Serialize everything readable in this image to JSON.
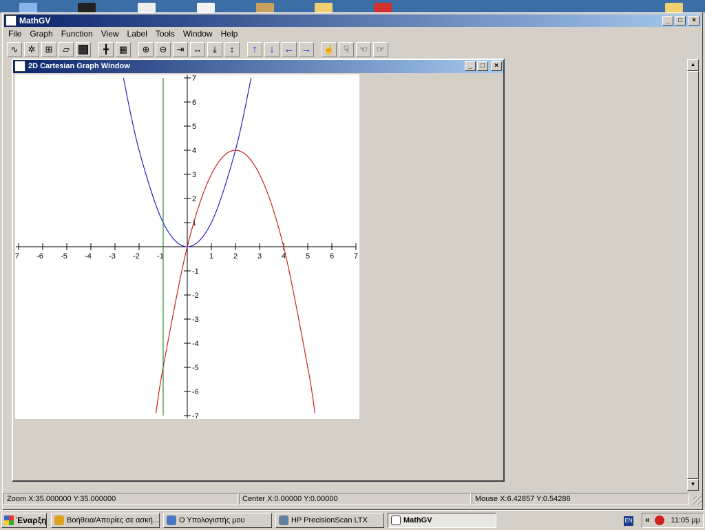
{
  "app": {
    "title": "MathGV",
    "window_buttons": [
      "_",
      "□",
      "×"
    ]
  },
  "menu": [
    "File",
    "Graph",
    "Function",
    "View",
    "Label",
    "Tools",
    "Window",
    "Help"
  ],
  "toolbar": [
    {
      "name": "graph-function-icon"
    },
    {
      "name": "polar-graph-icon"
    },
    {
      "name": "grid-graph-icon"
    },
    {
      "name": "open-folder-icon"
    },
    {
      "name": "save-disk-icon"
    },
    {
      "name": "axes-icon"
    },
    {
      "name": "grid-icon"
    },
    {
      "name": "zoom-in-icon"
    },
    {
      "name": "zoom-out-icon"
    },
    {
      "name": "shrink-horizontal-icon"
    },
    {
      "name": "expand-horizontal-icon"
    },
    {
      "name": "shrink-vertical-icon"
    },
    {
      "name": "expand-vertical-icon"
    },
    {
      "name": "arrow-up-icon"
    },
    {
      "name": "arrow-down-icon"
    },
    {
      "name": "arrow-left-icon"
    },
    {
      "name": "arrow-right-icon"
    },
    {
      "name": "hand-up-icon"
    },
    {
      "name": "hand-down-icon"
    },
    {
      "name": "hand-left-icon"
    },
    {
      "name": "hand-right-icon"
    }
  ],
  "child_window": {
    "title": "2D Cartesian Graph Window"
  },
  "chart_data": {
    "type": "line",
    "xlim": [
      -7,
      7
    ],
    "ylim": [
      -7,
      7
    ],
    "grid": false,
    "x_ticks": [
      -7,
      -6,
      -5,
      -4,
      -3,
      -2,
      -1,
      1,
      2,
      3,
      4,
      5,
      6,
      7
    ],
    "y_ticks": [
      7,
      6,
      5,
      4,
      3,
      2,
      1,
      -1,
      -2,
      -3,
      -4,
      -5,
      -6,
      -7
    ],
    "series": [
      {
        "color": "#1f1fc8",
        "x": [
          -2.65,
          -2,
          -1,
          0,
          1,
          2,
          2.65
        ],
        "y": [
          7,
          4,
          1,
          0,
          1,
          4,
          7
        ]
      },
      {
        "color": "#cc1f1f",
        "x": [
          -1.3,
          -1,
          0,
          1,
          2,
          3,
          4,
          5,
          5.3
        ],
        "y": [
          -6.9,
          -5,
          0,
          3,
          4,
          3,
          0,
          -5,
          -6.9
        ]
      },
      {
        "color": "#2e8b2e",
        "x": [
          -1,
          -1
        ],
        "y": [
          -7,
          7
        ]
      }
    ]
  },
  "status": {
    "zoom": "Zoom X:35.000000 Y:35.000000",
    "center": "Center X:0.00000 Y:0.00000",
    "mouse": "Mouse X:6.42857 Y:0.54286"
  },
  "taskbar": {
    "start": "Έναρξη",
    "tasks": [
      {
        "label": "Βοήθεια/Απορίες σε ασκή...",
        "color": "#e0a020"
      },
      {
        "label": "Ο Υπολογιστής μου",
        "color": "#4a78c0"
      },
      {
        "label": "HP PrecisionScan LTX",
        "color": "#6080a0"
      },
      {
        "label": "MathGV",
        "color": "#ffffff"
      }
    ],
    "language": "EN",
    "clock": "11:05 μμ"
  }
}
